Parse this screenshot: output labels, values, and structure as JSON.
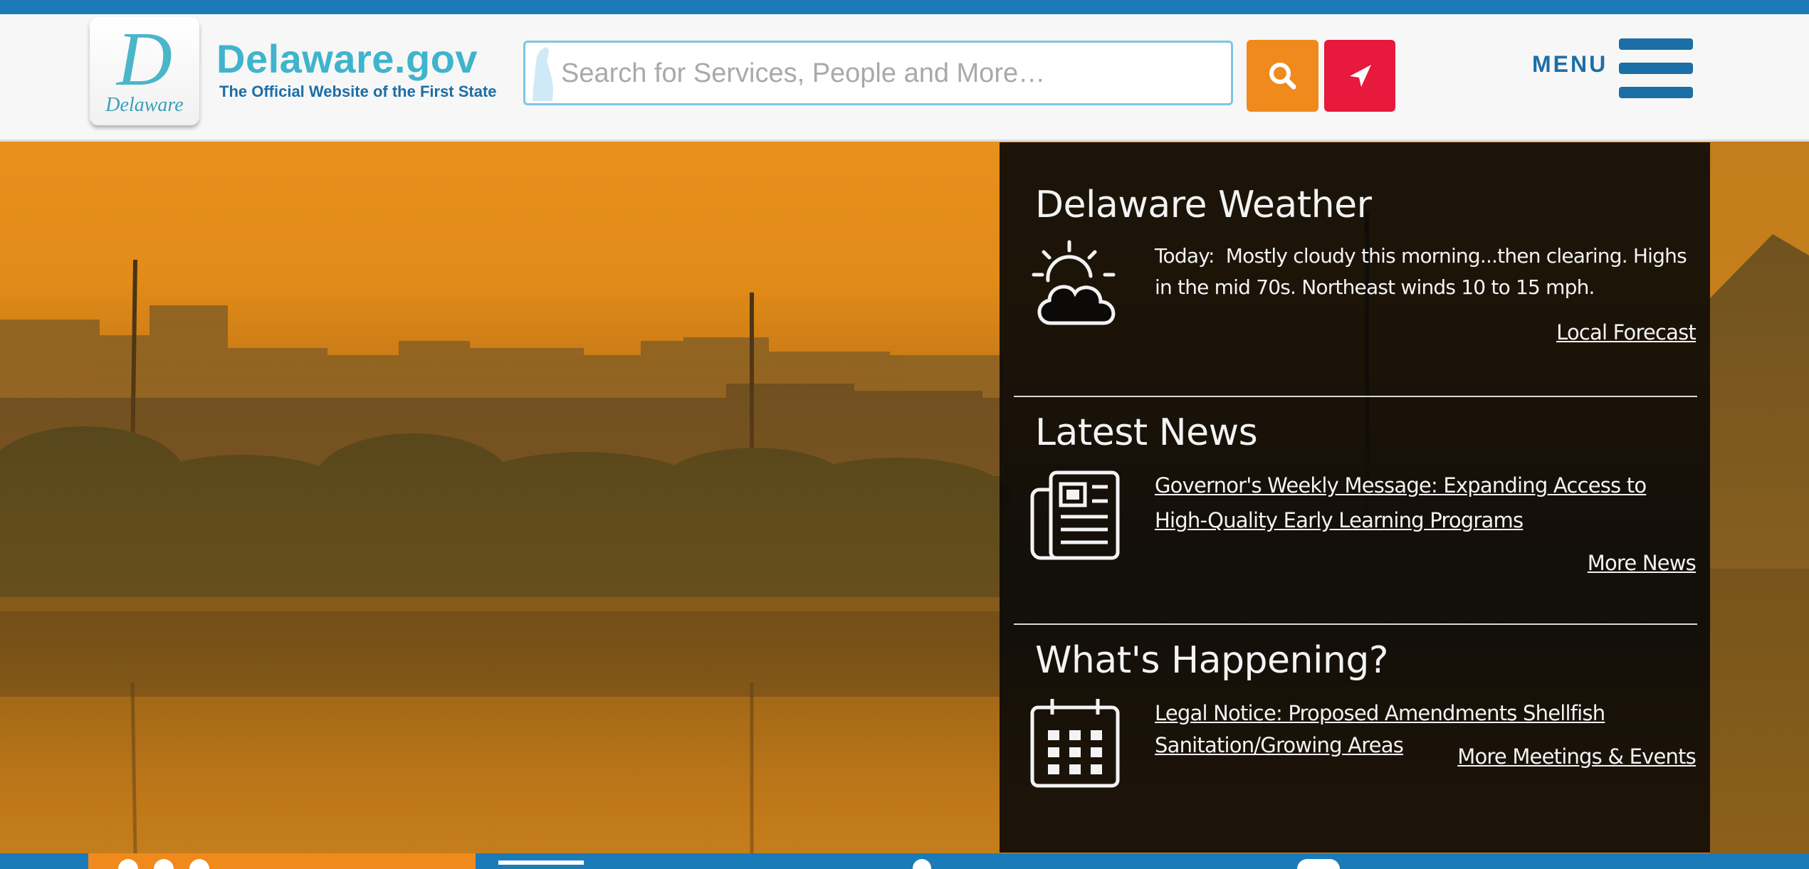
{
  "header": {
    "logo": {
      "caption": "Delaware",
      "initial": "D"
    },
    "site_name": "Delaware.gov",
    "tagline": "The Official Website of the First State",
    "search": {
      "placeholder": "Search for Services, People and More…",
      "value": ""
    },
    "buttons": {
      "search_icon": "search-icon",
      "locate_icon": "location-arrow-icon"
    },
    "menu_label": "MENU"
  },
  "weather": {
    "title": "Delaware Weather",
    "icon": "partly-cloudy-icon",
    "today_label": "Today:",
    "forecast_text": "Mostly cloudy this morning...then clearing. Highs in the mid 70s. Northeast winds 10 to 15 mph.",
    "link": "Local Forecast"
  },
  "news": {
    "title": "Latest News",
    "icon": "newspaper-icon",
    "headline": "Governor's Weekly Message: Expanding Access to High-Quality Early Learning Programs",
    "link": "More News"
  },
  "events": {
    "title": "What's Happening?",
    "icon": "calendar-icon",
    "item": "Legal Notice: Proposed Amendments Shellfish Sanitation/Growing Areas",
    "link": "More Meetings & Events"
  },
  "colors": {
    "brand_blue": "#1b7bb8",
    "logo_teal": "#3fb4cc",
    "search_orange": "#f08a1c",
    "locate_red": "#e7193c",
    "panel_bg": "#0c0a08"
  }
}
